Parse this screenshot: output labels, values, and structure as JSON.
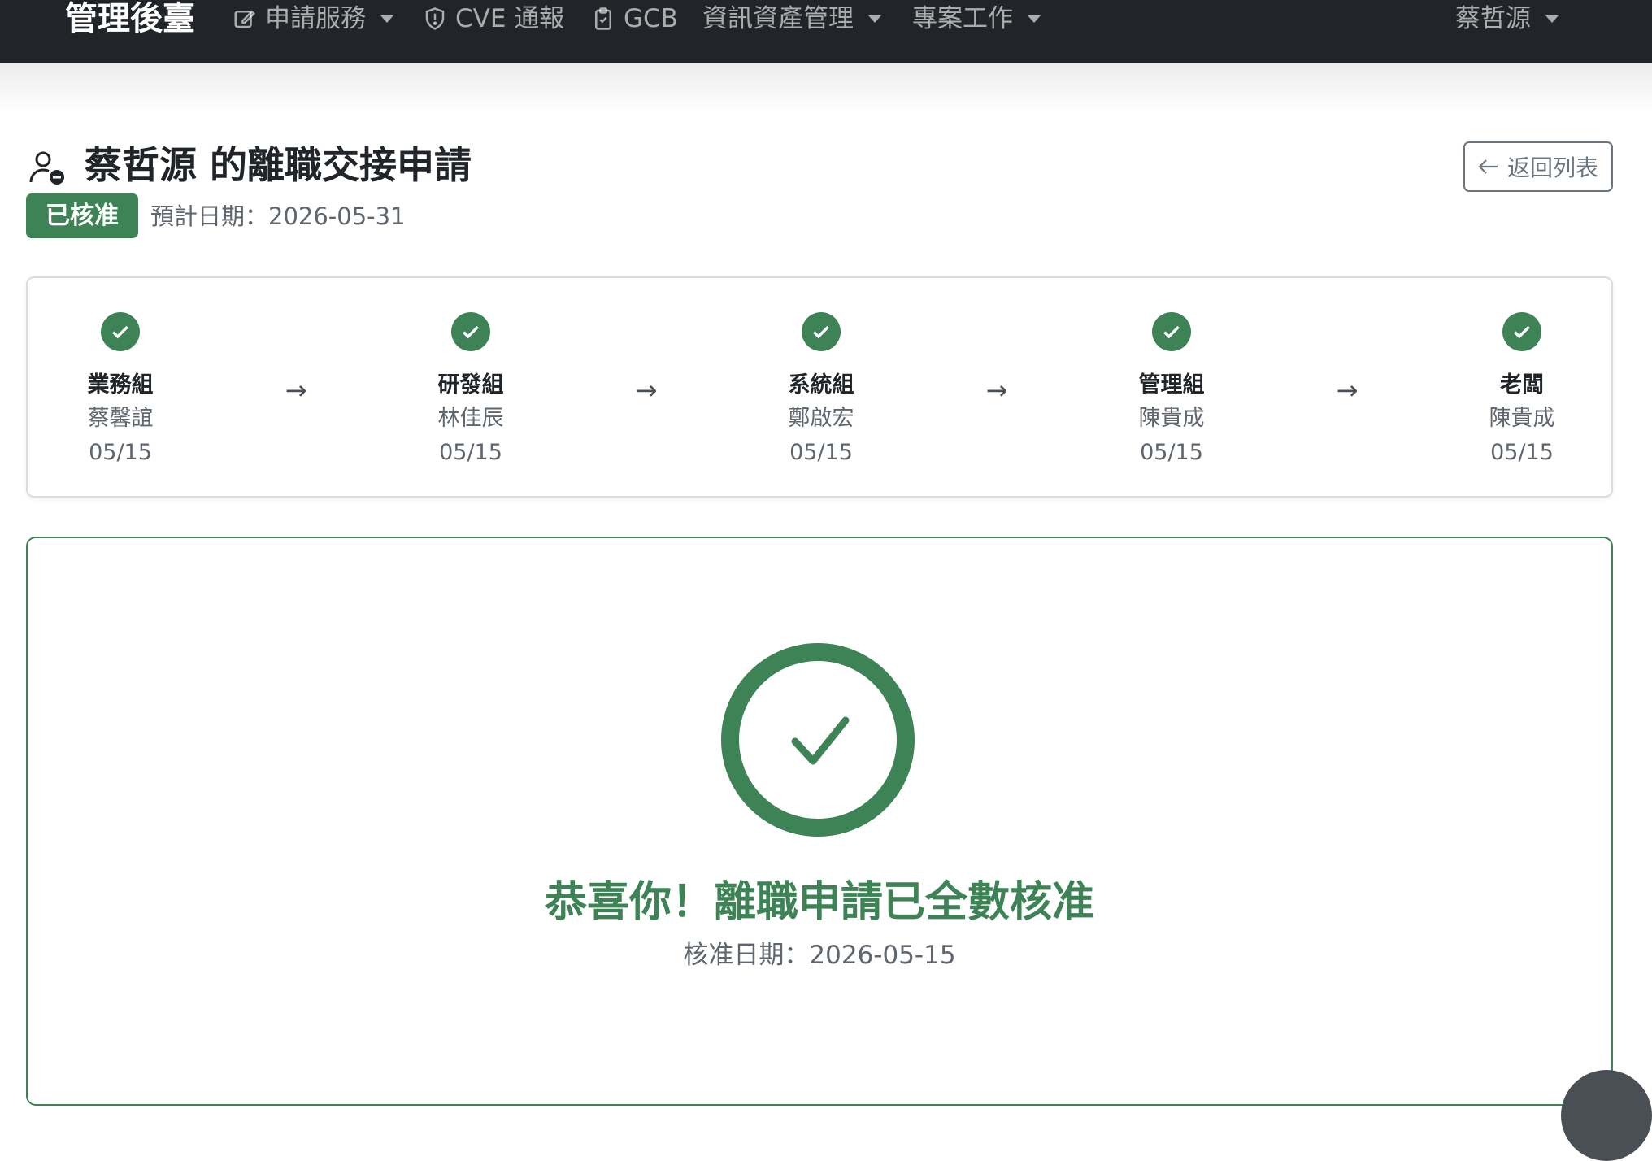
{
  "navbar": {
    "brand": "管理後臺",
    "items": [
      {
        "label": "申請服務",
        "icon": "edit-icon",
        "dropdown": true
      },
      {
        "label": "CVE 通報",
        "icon": "shield-alert-icon",
        "dropdown": false
      },
      {
        "label": "GCB",
        "icon": "clipboard-check-icon",
        "dropdown": false
      },
      {
        "label": "資訊資產管理",
        "icon": "",
        "dropdown": true
      },
      {
        "label": "專案工作",
        "icon": "",
        "dropdown": true
      }
    ],
    "user": "蔡哲源"
  },
  "header": {
    "icon": "person-remove-icon",
    "title": "蔡哲源 的離職交接申請",
    "status_badge": "已核准",
    "expected_date": "預計日期：2026-05-31",
    "back_button": {
      "icon": "arrow-left-icon",
      "label": "返回列表"
    }
  },
  "steps": [
    {
      "dept": "業務組",
      "person": "蔡馨誼",
      "date": "05/15"
    },
    {
      "dept": "研發組",
      "person": "林佳辰",
      "date": "05/15"
    },
    {
      "dept": "系統組",
      "person": "鄭啟宏",
      "date": "05/15"
    },
    {
      "dept": "管理組",
      "person": "陳貴成",
      "date": "05/15"
    },
    {
      "dept": "老闆",
      "person": "陳貴成",
      "date": "05/15"
    }
  ],
  "step_arrow": "→",
  "result": {
    "icon": "large-check-circle-icon",
    "title": "恭喜你！離職申請已全數核准",
    "approved_date": "核准日期：2026-05-15"
  },
  "colors": {
    "navbar": "#212529",
    "success": "#3d8355",
    "muted": "#5f666d"
  }
}
